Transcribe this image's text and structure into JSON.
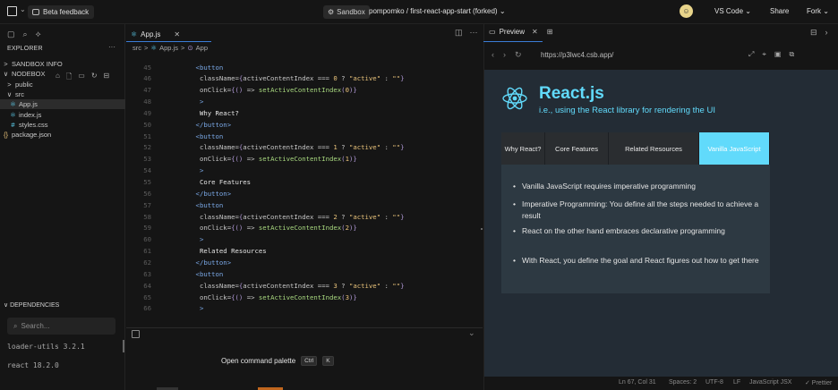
{
  "topbar": {
    "beta_label": "Beta feedback",
    "sandbox_label": "Sandbox",
    "project": "pompomko / first-react-app-start (forked)",
    "editor_menu": "VS Code",
    "share": "Share",
    "fork": "Fork"
  },
  "sidebar": {
    "title": "EXPLORER",
    "items": [
      {
        "label": "SANDBOX INFO",
        "glyph": ">",
        "indent": 0
      },
      {
        "label": "NODEBOX",
        "glyph": "∨",
        "indent": 0
      },
      {
        "label": "public",
        "glyph": ">",
        "indent": 1
      },
      {
        "label": "src",
        "glyph": "∨",
        "indent": 1
      },
      {
        "label": "App.js",
        "glyph": "⚛",
        "indent": 2
      },
      {
        "label": "index.js",
        "glyph": "⚛",
        "indent": 2
      },
      {
        "label": "styles.css",
        "glyph": "#",
        "indent": 2
      },
      {
        "label": "package.json",
        "glyph": "{}",
        "indent": 0
      }
    ],
    "dependencies_title": "DEPENDENCIES",
    "search_placeholder": "Search...",
    "dependencies": [
      "loader-utils  3.2.1",
      "react  18.2.0"
    ]
  },
  "editor": {
    "tab_label": "App.js",
    "breadcrumb": [
      "src",
      ">",
      "App.js",
      ">",
      "App"
    ],
    "lines": [
      {
        "n": "45",
        "text": "<button",
        "kind": "open"
      },
      {
        "n": "46",
        "text": "className={activeContentIndex === 0 ? \"active\" : \"\"}",
        "kind": "attr"
      },
      {
        "n": "47",
        "text": "onClick={() => setActiveContentIndex(0)}",
        "kind": "click"
      },
      {
        "n": "48",
        "text": ">",
        "kind": "gt"
      },
      {
        "n": "49",
        "text": "Why React?",
        "kind": "text"
      },
      {
        "n": "50",
        "text": "</button>",
        "kind": "close"
      },
      {
        "n": "51",
        "text": "<button",
        "kind": "open"
      },
      {
        "n": "52",
        "text": "className={activeContentIndex === 1 ? \"active\" : \"\"}",
        "kind": "attr"
      },
      {
        "n": "53",
        "text": "onClick={() => setActiveContentIndex(1)}",
        "kind": "click"
      },
      {
        "n": "54",
        "text": ">",
        "kind": "gt"
      },
      {
        "n": "55",
        "text": "Core Features",
        "kind": "text"
      },
      {
        "n": "56",
        "text": "</button>",
        "kind": "close"
      },
      {
        "n": "57",
        "text": "<button",
        "kind": "open"
      },
      {
        "n": "58",
        "text": "className={activeContentIndex === 2 ? \"active\" : \"\"}",
        "kind": "attr"
      },
      {
        "n": "59",
        "text": "onClick={() => setActiveContentIndex(2)}",
        "kind": "click"
      },
      {
        "n": "60",
        "text": ">",
        "kind": "gt"
      },
      {
        "n": "61",
        "text": "Related Resources",
        "kind": "text"
      },
      {
        "n": "62",
        "text": "</button>",
        "kind": "close"
      },
      {
        "n": "63",
        "text": "<button",
        "kind": "open"
      },
      {
        "n": "64",
        "text": "className={activeContentIndex === 3 ? \"active\" : \"\"}",
        "kind": "attr"
      },
      {
        "n": "65",
        "text": "onClick={() => setActiveContentIndex(3)}",
        "kind": "click"
      },
      {
        "n": "66",
        "text": ">",
        "kind": "gt"
      }
    ],
    "command_palette": "Open command palette",
    "kbd_ctrl": "Ctrl",
    "kbd_k": "K"
  },
  "preview": {
    "tab_label": "Preview",
    "url": "https://p3lwc4.csb.app/",
    "title": "React.js",
    "subtitle": "i.e., using the React library for rendering the UI",
    "menu": [
      {
        "label": "Why React?",
        "active": false
      },
      {
        "label": "Core Features",
        "active": false
      },
      {
        "label": "Related Resources",
        "active": false
      },
      {
        "label": "Vanilla JavaScript",
        "active": true
      }
    ],
    "bullets": [
      "Vanilla JavaScript requires imperative programming",
      "Imperative Programming: You define all the steps needed to achieve a result",
      "React on the other hand embraces declarative programming",
      "With React, you define the goal and React figures out how to get there"
    ],
    "accent": "#61dafb"
  },
  "statusbar": {
    "position": "Ln 67, Col 31",
    "spaces": "Spaces: 2",
    "encoding": "UTF-8",
    "eol": "LF",
    "language": "JavaScript JSX",
    "formatter": "✓ Prettier"
  }
}
